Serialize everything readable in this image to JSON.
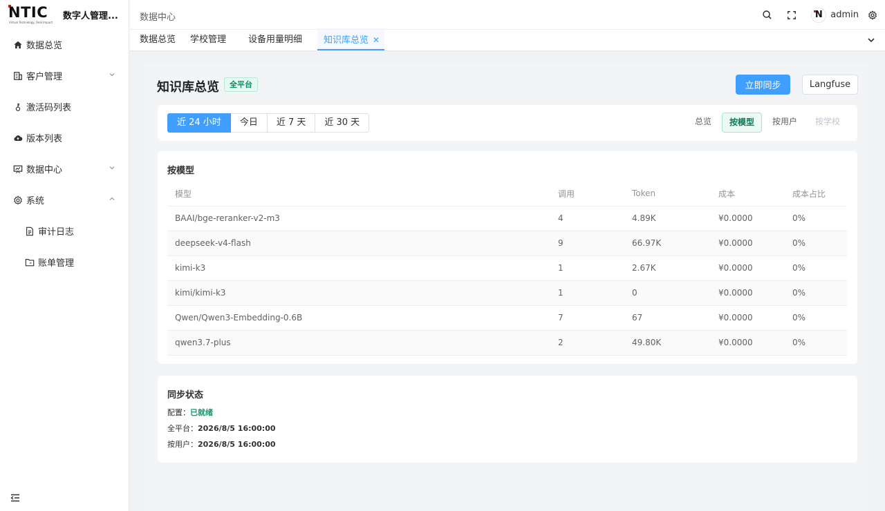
{
  "brand": {
    "logo_text": "NTIC",
    "logo_sub": "Virtual Technology, Real Impact",
    "app_title": "数字人管理..."
  },
  "sidebar": {
    "items": [
      {
        "label": "数据总览",
        "icon": "home-icon"
      },
      {
        "label": "客户管理",
        "icon": "building-icon"
      },
      {
        "label": "激活码列表",
        "icon": "key-icon"
      },
      {
        "label": "版本列表",
        "icon": "cloud-upload-icon"
      },
      {
        "label": "数据中心",
        "icon": "chart-board-icon"
      },
      {
        "label": "系统",
        "icon": "gear-icon"
      },
      {
        "label": "审计日志",
        "icon": "document-icon"
      },
      {
        "label": "账单管理",
        "icon": "folder-icon"
      }
    ]
  },
  "header": {
    "breadcrumb": "数据中心",
    "username": "admin",
    "avatar_letter": "N"
  },
  "tabs": [
    {
      "label": "数据总览"
    },
    {
      "label": "学校管理"
    },
    {
      "label": "设备用量明细"
    },
    {
      "label": "知识库总览",
      "active": true
    }
  ],
  "page": {
    "title": "知识库总览",
    "badge": "全平台",
    "sync_button": "立即同步",
    "langfuse_button": "Langfuse"
  },
  "filters": {
    "ranges": [
      "近 24 小时",
      "今日",
      "近 7 天",
      "近 30 天"
    ],
    "active_range": "近 24 小时",
    "views": [
      "总览",
      "按模型",
      "按用户",
      "按学校"
    ],
    "active_view": "按模型"
  },
  "model_table": {
    "title": "按模型",
    "columns": [
      "模型",
      "调用",
      "Token",
      "成本",
      "成本占比"
    ],
    "rows": [
      [
        "BAAI/bge-reranker-v2-m3",
        "4",
        "4.89K",
        "¥0.0000",
        "0%"
      ],
      [
        "deepseek-v4-flash",
        "9",
        "66.97K",
        "¥0.0000",
        "0%"
      ],
      [
        "kimi-k3",
        "1",
        "2.67K",
        "¥0.0000",
        "0%"
      ],
      [
        "kimi/kimi-k3",
        "1",
        "0",
        "¥0.0000",
        "0%"
      ],
      [
        "Qwen/Qwen3-Embedding-0.6B",
        "7",
        "67",
        "¥0.0000",
        "0%"
      ],
      [
        "qwen3.7-plus",
        "2",
        "49.80K",
        "¥0.0000",
        "0%"
      ]
    ]
  },
  "sync_status": {
    "title": "同步状态",
    "config_label": "配置：",
    "config_value": "已就绪",
    "platform_label": "全平台：",
    "platform_value": "2026/8/5 16:00:00",
    "user_label": "按用户：",
    "user_value": "2026/8/5 16:00:00"
  },
  "colors": {
    "primary": "#409eff",
    "success": "#0f9968",
    "badge_bg": "#e5f8f1"
  }
}
